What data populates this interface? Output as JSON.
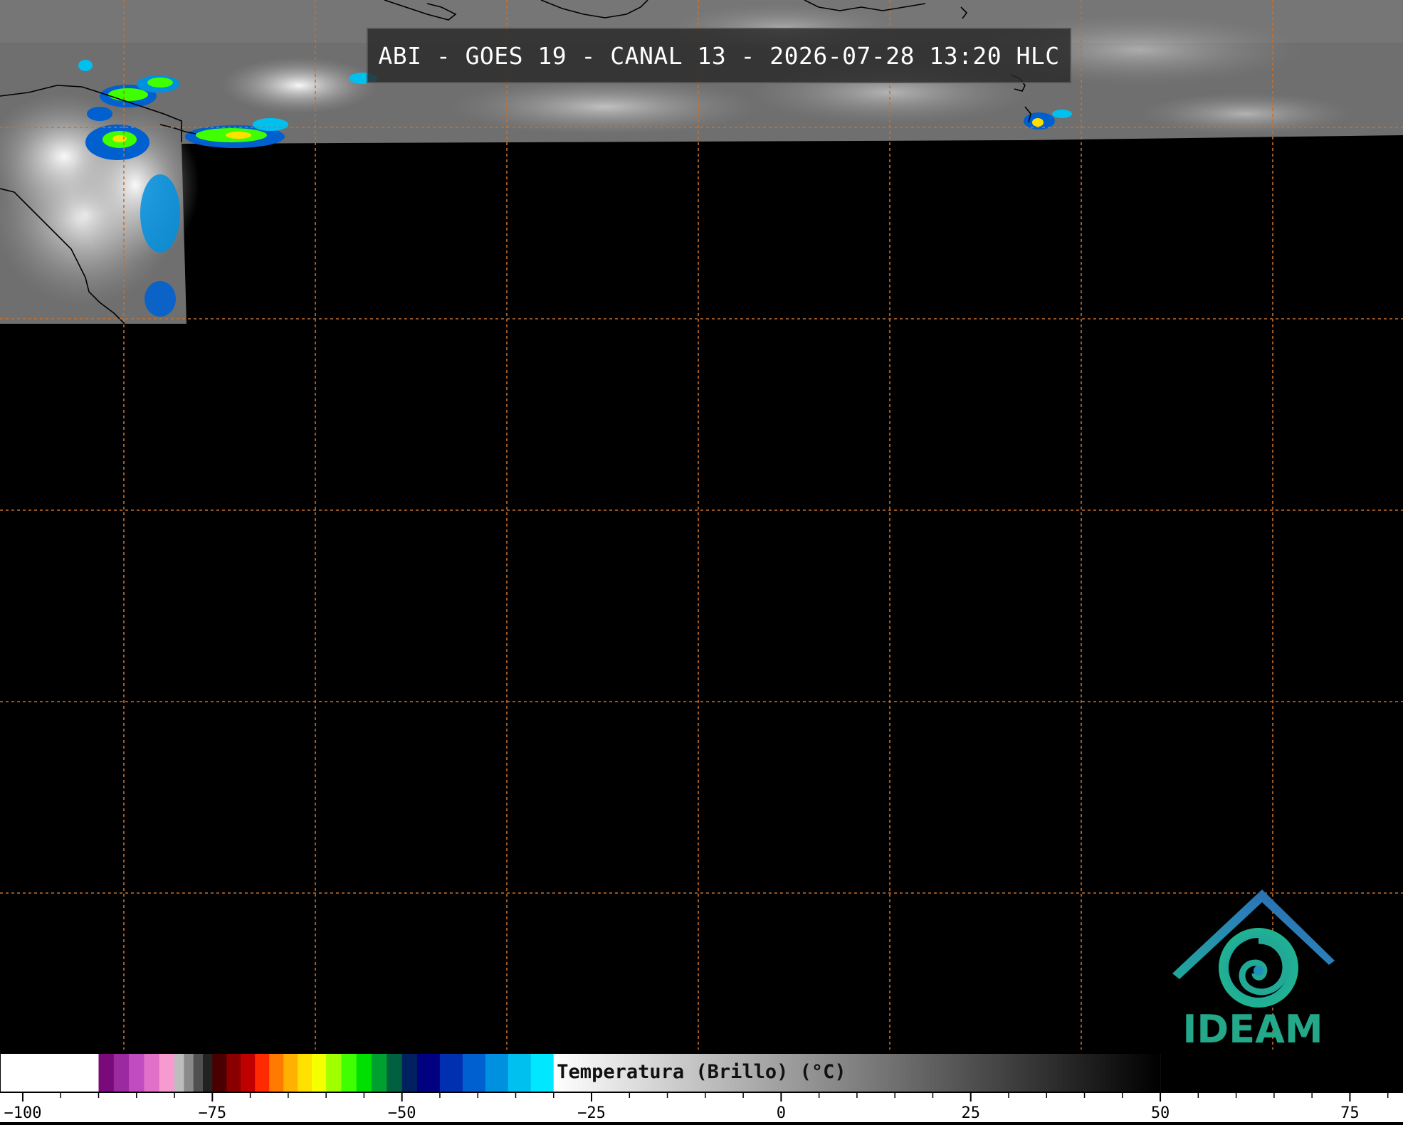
{
  "title": "ABI - GOES 19 - CANAL 13 - 2026-07-28 13:20 HLC",
  "logo": {
    "text": "IDEAM"
  },
  "colorbar": {
    "label": "Temperatura (Brillo) (°C)",
    "range": [
      -103,
      82
    ],
    "ticks": [
      {
        "value": -100,
        "label": "−100"
      },
      {
        "value": -75,
        "label": "−75"
      },
      {
        "value": -50,
        "label": "−50"
      },
      {
        "value": -25,
        "label": "−25"
      },
      {
        "value": 0,
        "label": "0"
      },
      {
        "value": 25,
        "label": "25"
      },
      {
        "value": 50,
        "label": "50"
      },
      {
        "value": 75,
        "label": "75"
      }
    ],
    "colors": {
      "white_end": "#ffffff",
      "purples": [
        "#7a0a7a",
        "#9b2aa0",
        "#c04cc0",
        "#e070c8",
        "#f69ad0"
      ],
      "grays_cold": [
        "#bdbdbd",
        "#8a8a8a",
        "#505050",
        "#222222"
      ],
      "reds": [
        "#4a0000",
        "#8a0000",
        "#c00000",
        "#ff2a00",
        "#ff7a00",
        "#ffb000",
        "#ffe000",
        "#f4ff00"
      ],
      "greens": [
        "#a0ff00",
        "#40ff00",
        "#00e000",
        "#00a030",
        "#006040",
        "#002060"
      ],
      "blues": [
        "#000080",
        "#0030b0",
        "#0060d0",
        "#0090e0",
        "#00c0f0",
        "#00e8ff"
      ],
      "gray_ramp": [
        "#ffffff",
        "#000000"
      ]
    }
  },
  "grid": {
    "color": "#c8702a"
  }
}
